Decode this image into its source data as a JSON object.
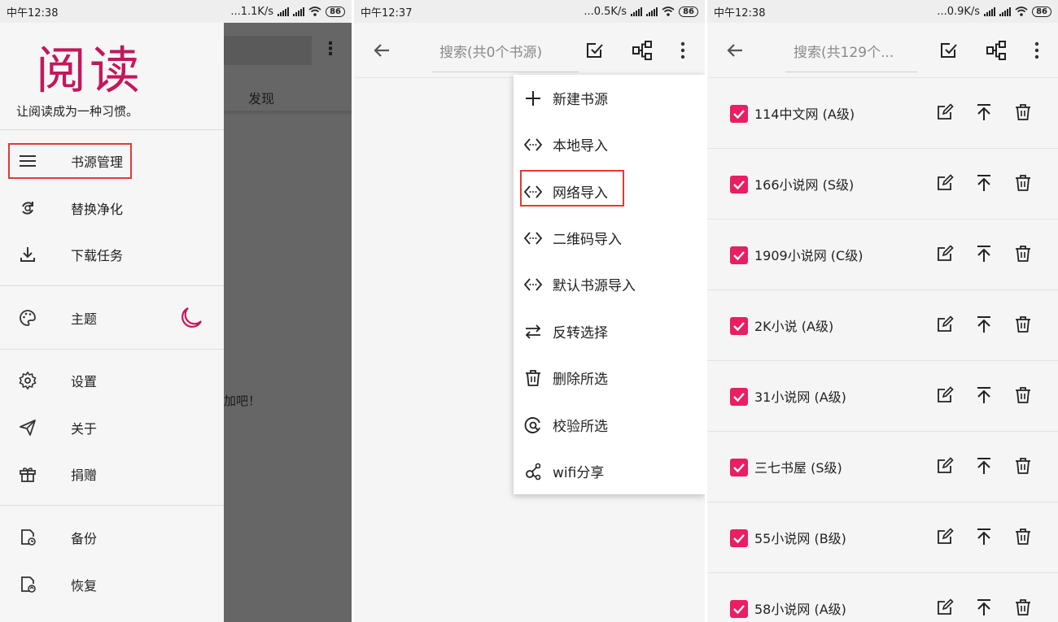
{
  "panel1": {
    "status": {
      "time": "中午12:38",
      "speed": "...1.1K/s",
      "battery": "86"
    },
    "behind": {
      "tab": "发现",
      "hint": "加吧！"
    },
    "logo": "阅读",
    "slogan": "让阅读成为一种习惯。",
    "nav": [
      {
        "label": "书源管理",
        "icon": "menu-lines-icon"
      },
      {
        "label": "替换净化",
        "icon": "replace-icon"
      },
      {
        "label": "下载任务",
        "icon": "download-icon"
      },
      {
        "label": "主题",
        "icon": "palette-icon"
      },
      {
        "label": "设置",
        "icon": "gear-icon"
      },
      {
        "label": "关于",
        "icon": "send-icon"
      },
      {
        "label": "捐赠",
        "icon": "gift-icon"
      },
      {
        "label": "备份",
        "icon": "backup-icon"
      },
      {
        "label": "恢复",
        "icon": "restore-icon"
      }
    ]
  },
  "panel2": {
    "status": {
      "time": "中午12:37",
      "speed": "...0.5K/s",
      "battery": "86"
    },
    "search_placeholder": "搜索(共0个书源)",
    "menu": [
      {
        "label": "新建书源",
        "icon": "plus-icon"
      },
      {
        "label": "本地导入",
        "icon": "code-icon"
      },
      {
        "label": "网络导入",
        "icon": "code-icon"
      },
      {
        "label": "二维码导入",
        "icon": "code-icon"
      },
      {
        "label": "默认书源导入",
        "icon": "code-icon"
      },
      {
        "label": "反转选择",
        "icon": "swap-icon"
      },
      {
        "label": "删除所选",
        "icon": "trash-icon"
      },
      {
        "label": "校验所选",
        "icon": "check-circle-icon"
      },
      {
        "label": "wifi分享",
        "icon": "share-icon"
      }
    ]
  },
  "panel3": {
    "status": {
      "time": "中午12:38",
      "speed": "...0.9K/s",
      "battery": "86"
    },
    "search_placeholder": "搜索(共129个...",
    "sources": [
      {
        "name": "114中文网 (A级)",
        "checked": true
      },
      {
        "name": "166小说网 (S级)",
        "checked": true
      },
      {
        "name": "1909小说网 (C级)",
        "checked": true
      },
      {
        "name": "2K小说 (A级)",
        "checked": true
      },
      {
        "name": "31小说网 (A级)",
        "checked": true
      },
      {
        "name": "三七书屋 (S级)",
        "checked": true
      },
      {
        "name": "55小说网 (B级)",
        "checked": true
      },
      {
        "name": "58小说网 (A级)",
        "checked": true
      }
    ]
  },
  "colors": {
    "accent": "#e91e63",
    "logo": "#c2185b",
    "highlight": "#e53935"
  }
}
